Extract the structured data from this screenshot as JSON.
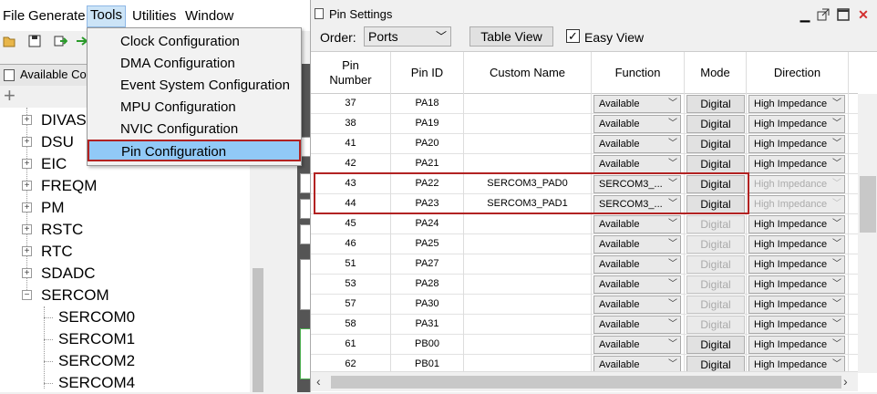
{
  "menubar": {
    "items": [
      "File",
      "Generate",
      "Tools",
      "Utilities",
      "Window"
    ]
  },
  "left_panel": {
    "tab_label": "Available Co",
    "tree_items": [
      {
        "label": "DIVAS",
        "level": 0,
        "expander": "+"
      },
      {
        "label": "DSU",
        "level": 0,
        "expander": "+"
      },
      {
        "label": "EIC",
        "level": 0,
        "expander": "+"
      },
      {
        "label": "FREQM",
        "level": 0,
        "expander": "+"
      },
      {
        "label": "PM",
        "level": 0,
        "expander": "+"
      },
      {
        "label": "RSTC",
        "level": 0,
        "expander": "+"
      },
      {
        "label": "RTC",
        "level": 0,
        "expander": "+"
      },
      {
        "label": "SDADC",
        "level": 0,
        "expander": "+"
      },
      {
        "label": "SERCOM",
        "level": 0,
        "expander": "−"
      },
      {
        "label": "SERCOM0",
        "level": 1
      },
      {
        "label": "SERCOM1",
        "level": 1
      },
      {
        "label": "SERCOM2",
        "level": 1
      },
      {
        "label": "SERCOM4",
        "level": 1
      }
    ]
  },
  "tools_menu": {
    "items": [
      "Clock Configuration",
      "DMA Configuration",
      "Event System Configuration",
      "MPU Configuration",
      "NVIC Configuration",
      "Pin Configuration"
    ],
    "highlighted": "Pin Configuration"
  },
  "pin_settings": {
    "title": "Pin Settings",
    "order_label": "Order:",
    "order_value": "Ports",
    "table_view_label": "Table View",
    "easy_view_label": "Easy View",
    "easy_view_checked": "✓",
    "columns": [
      "Pin Number",
      "Pin ID",
      "Custom Name",
      "Function",
      "Mode",
      "Direction"
    ],
    "rows": [
      {
        "pin": "37",
        "id": "PA18",
        "name": "",
        "function": "Available",
        "mode": "Digital",
        "mode_enabled": true,
        "direction": "High Impedance",
        "dir_enabled": true
      },
      {
        "pin": "38",
        "id": "PA19",
        "name": "",
        "function": "Available",
        "mode": "Digital",
        "mode_enabled": true,
        "direction": "High Impedance",
        "dir_enabled": true
      },
      {
        "pin": "41",
        "id": "PA20",
        "name": "",
        "function": "Available",
        "mode": "Digital",
        "mode_enabled": true,
        "direction": "High Impedance",
        "dir_enabled": true
      },
      {
        "pin": "42",
        "id": "PA21",
        "name": "",
        "function": "Available",
        "mode": "Digital",
        "mode_enabled": true,
        "direction": "High Impedance",
        "dir_enabled": true
      },
      {
        "pin": "43",
        "id": "PA22",
        "name": "SERCOM3_PAD0",
        "function": "SERCOM3_...",
        "mode": "Digital",
        "mode_enabled": true,
        "direction": "High Impedance",
        "dir_enabled": false
      },
      {
        "pin": "44",
        "id": "PA23",
        "name": "SERCOM3_PAD1",
        "function": "SERCOM3_...",
        "mode": "Digital",
        "mode_enabled": true,
        "direction": "High Impedance",
        "dir_enabled": false
      },
      {
        "pin": "45",
        "id": "PA24",
        "name": "",
        "function": "Available",
        "mode": "Digital",
        "mode_enabled": false,
        "direction": "High Impedance",
        "dir_enabled": true
      },
      {
        "pin": "46",
        "id": "PA25",
        "name": "",
        "function": "Available",
        "mode": "Digital",
        "mode_enabled": false,
        "direction": "High Impedance",
        "dir_enabled": true
      },
      {
        "pin": "51",
        "id": "PA27",
        "name": "",
        "function": "Available",
        "mode": "Digital",
        "mode_enabled": false,
        "direction": "High Impedance",
        "dir_enabled": true
      },
      {
        "pin": "53",
        "id": "PA28",
        "name": "",
        "function": "Available",
        "mode": "Digital",
        "mode_enabled": false,
        "direction": "High Impedance",
        "dir_enabled": true
      },
      {
        "pin": "57",
        "id": "PA30",
        "name": "",
        "function": "Available",
        "mode": "Digital",
        "mode_enabled": false,
        "direction": "High Impedance",
        "dir_enabled": true
      },
      {
        "pin": "58",
        "id": "PA31",
        "name": "",
        "function": "Available",
        "mode": "Digital",
        "mode_enabled": false,
        "direction": "High Impedance",
        "dir_enabled": true
      },
      {
        "pin": "61",
        "id": "PB00",
        "name": "",
        "function": "Available",
        "mode": "Digital",
        "mode_enabled": true,
        "direction": "High Impedance",
        "dir_enabled": true
      },
      {
        "pin": "62",
        "id": "PB01",
        "name": "",
        "function": "Available",
        "mode": "Digital",
        "mode_enabled": true,
        "direction": "High Impedance",
        "dir_enabled": true
      }
    ]
  },
  "colors": {
    "highlight_border": "#b22222",
    "menu_selected": "#91c9f7"
  }
}
